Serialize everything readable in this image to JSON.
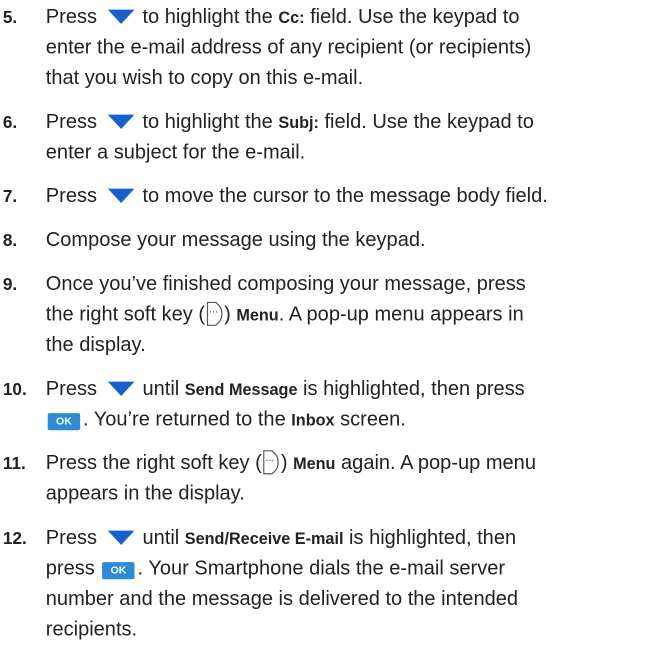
{
  "icons": {
    "down": "down-arrow-navigation-key",
    "ok": "ok-key",
    "softkey": "right-soft-key"
  },
  "colors": {
    "arrow": "#1a5fd1",
    "ok_key": "#2f8ad6"
  },
  "ok_label": "OK",
  "steps": [
    {
      "number": "5.",
      "lines": [
        [
          "Press ",
          " to highlight the ",
          "Cc:",
          " field. Use the keypad to"
        ],
        [
          "enter the e-mail address of any recipient (or recipients)"
        ],
        [
          "that you wish to copy on this e-mail."
        ]
      ]
    },
    {
      "number": "6.",
      "lines": [
        [
          "Press ",
          " to highlight the ",
          "Subj:",
          " field. Use the keypad to"
        ],
        [
          "enter a subject for the e-mail."
        ]
      ]
    },
    {
      "number": "7.",
      "lines": [
        [
          "Press ",
          " to move the cursor to the message body field."
        ]
      ]
    },
    {
      "number": "8.",
      "lines": [
        [
          "Compose your message using the keypad."
        ]
      ]
    },
    {
      "number": "9.",
      "lines": [
        [
          "Once you’ve finished composing your message, press"
        ],
        [
          "the right soft key (",
          ") ",
          "Menu",
          ". A pop-up menu appears in"
        ],
        [
          "the display."
        ]
      ]
    },
    {
      "number": "10.",
      "lines": [
        [
          "Press ",
          " until ",
          "Send Message",
          " is highlighted, then press"
        ],
        [
          "",
          ". You’re returned to the ",
          "Inbox",
          " screen."
        ]
      ]
    },
    {
      "number": "11.",
      "lines": [
        [
          "Press the right soft key (",
          ") ",
          "Menu",
          " again. A pop-up menu"
        ],
        [
          "appears in the display."
        ]
      ]
    },
    {
      "number": "12.",
      "lines": [
        [
          "Press ",
          " until ",
          "Send/Receive E-mail",
          " is highlighted, then"
        ],
        [
          "press ",
          ". Your Smartphone dials the e-mail server"
        ],
        [
          "number and the message is delivered to the intended"
        ],
        [
          "recipients."
        ]
      ]
    }
  ]
}
